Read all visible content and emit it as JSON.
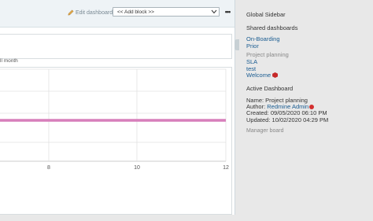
{
  "toolbar": {
    "edit_label": "Edit dashboard",
    "add_block_value": "<< Add block >>",
    "more_label": "•••"
  },
  "main": {
    "month_label": "ll month"
  },
  "chart_data": {
    "type": "line",
    "x_ticks": [
      "8",
      "10",
      "12"
    ],
    "series": [
      {
        "values": [
          1,
          1,
          1,
          1,
          1,
          1,
          1
        ],
        "color": "#d77fbb"
      }
    ],
    "grid": true,
    "title": "",
    "xlabel": "",
    "ylabel": ""
  },
  "sidebar": {
    "title": "Global Sidebar",
    "shared_heading": "Shared dashboards",
    "shared_items": [
      "On-Boarding",
      "Prior"
    ],
    "project_heading": "Project planning",
    "project_items": [
      "SLA",
      "test",
      "Welcome"
    ],
    "active_heading": "Active Dashboard",
    "name_line": "Name: Project planning",
    "author_prefix": "Author: ",
    "author_name": "Redmine Admin",
    "created_line": "Created: 09/05/2020 06:10 PM",
    "updated_line": "Updated: 10/02/2020 04:29 PM",
    "manager_board": "Manager board"
  },
  "colors": {
    "accent_link": "#1a5c91",
    "series_line": "#d77fbb"
  }
}
